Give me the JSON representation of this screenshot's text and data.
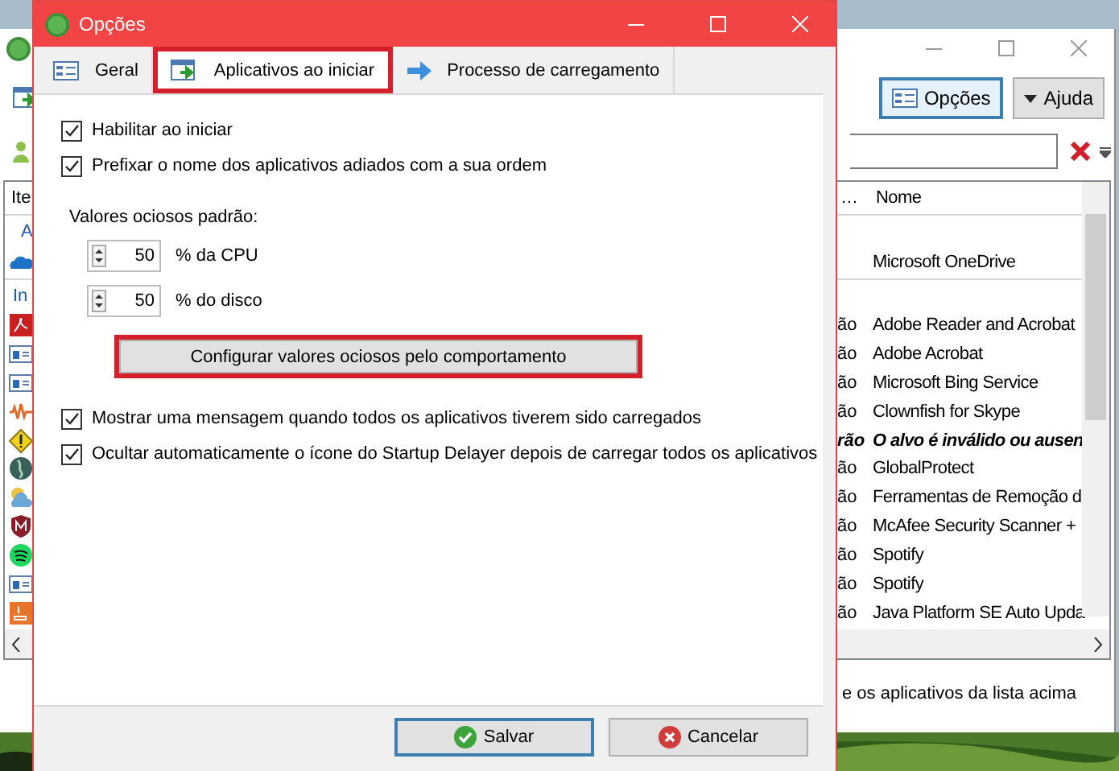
{
  "main_window": {
    "toolbar": {
      "buttons": [
        {
          "label": "Opções",
          "selected": true,
          "kind": "options"
        },
        {
          "label": "Ajuda",
          "selected": false,
          "kind": "menu"
        }
      ]
    },
    "list": {
      "columns": [
        "Ite",
        "…",
        "Nome"
      ],
      "groups": [
        {
          "label": "A",
          "items": [
            {
              "kind": "cloud",
              "name": "Microsoft OneDrive",
              "invalid": false
            }
          ]
        },
        {
          "label": "In",
          "items": [
            {
              "kind": "pdf",
              "status": "ão",
              "name": "Adobe Reader and Acrobat",
              "invalid": false
            },
            {
              "kind": "window",
              "status": "ão",
              "name": "Adobe Acrobat",
              "invalid": false
            },
            {
              "kind": "window",
              "status": "ão",
              "name": "Microsoft Bing Service",
              "invalid": false
            },
            {
              "kind": "wave",
              "status": "ão",
              "name": "Clownfish for Skype",
              "invalid": false
            },
            {
              "kind": "warning",
              "status": "rão",
              "name": "O alvo é inválido ou ausen",
              "invalid": true
            },
            {
              "kind": "globe",
              "status": "ão",
              "name": "GlobalProtect",
              "invalid": false
            },
            {
              "kind": "weather",
              "status": "ão",
              "name": "Ferramentas de Remoção d",
              "invalid": false
            },
            {
              "kind": "shield",
              "status": "ão",
              "name": "McAfee Security Scanner +",
              "invalid": false
            },
            {
              "kind": "spotify",
              "status": "ão",
              "name": "Spotify",
              "invalid": false
            },
            {
              "kind": "window",
              "status": "ão",
              "name": "Spotify",
              "invalid": false
            },
            {
              "kind": "java",
              "status": "ão",
              "name": "Java Platform SE Auto Upda",
              "invalid": false
            }
          ]
        }
      ]
    },
    "footer_text": "e os aplicativos da lista acima"
  },
  "dialog": {
    "title": "Opções",
    "tabs": [
      {
        "label": "Geral",
        "selected": false,
        "highlighted": false,
        "kind": "form"
      },
      {
        "label": "Aplicativos ao iniciar",
        "selected": true,
        "highlighted": true,
        "kind": "launch"
      },
      {
        "label": "Processo de carregamento",
        "selected": false,
        "highlighted": false,
        "kind": "arrow"
      }
    ],
    "top_options": [
      {
        "label": "Habilitar ao iniciar",
        "checked": true
      },
      {
        "label": "Prefixar o nome dos aplicativos adiados com a sua ordem",
        "checked": true
      }
    ],
    "idle_heading": "Valores ociosos padrão:",
    "spinners": [
      {
        "value": "50",
        "label": "% da CPU"
      },
      {
        "value": "50",
        "label": "% do disco"
      }
    ],
    "configure_button": {
      "label": "Configurar valores ociosos pelo comportamento",
      "highlighted": true
    },
    "bottom_options": [
      {
        "label": "Mostrar uma mensagem quando todos os aplicativos tiverem sido carregados",
        "checked": true
      },
      {
        "label": "Ocultar automaticamente o ícone do Startup Delayer depois de carregar todos os aplicativos",
        "checked": true
      }
    ],
    "buttons": [
      {
        "label": "Salvar",
        "kind": "ok",
        "focused": true
      },
      {
        "label": "Cancelar",
        "kind": "cancel",
        "focused": false
      }
    ]
  }
}
